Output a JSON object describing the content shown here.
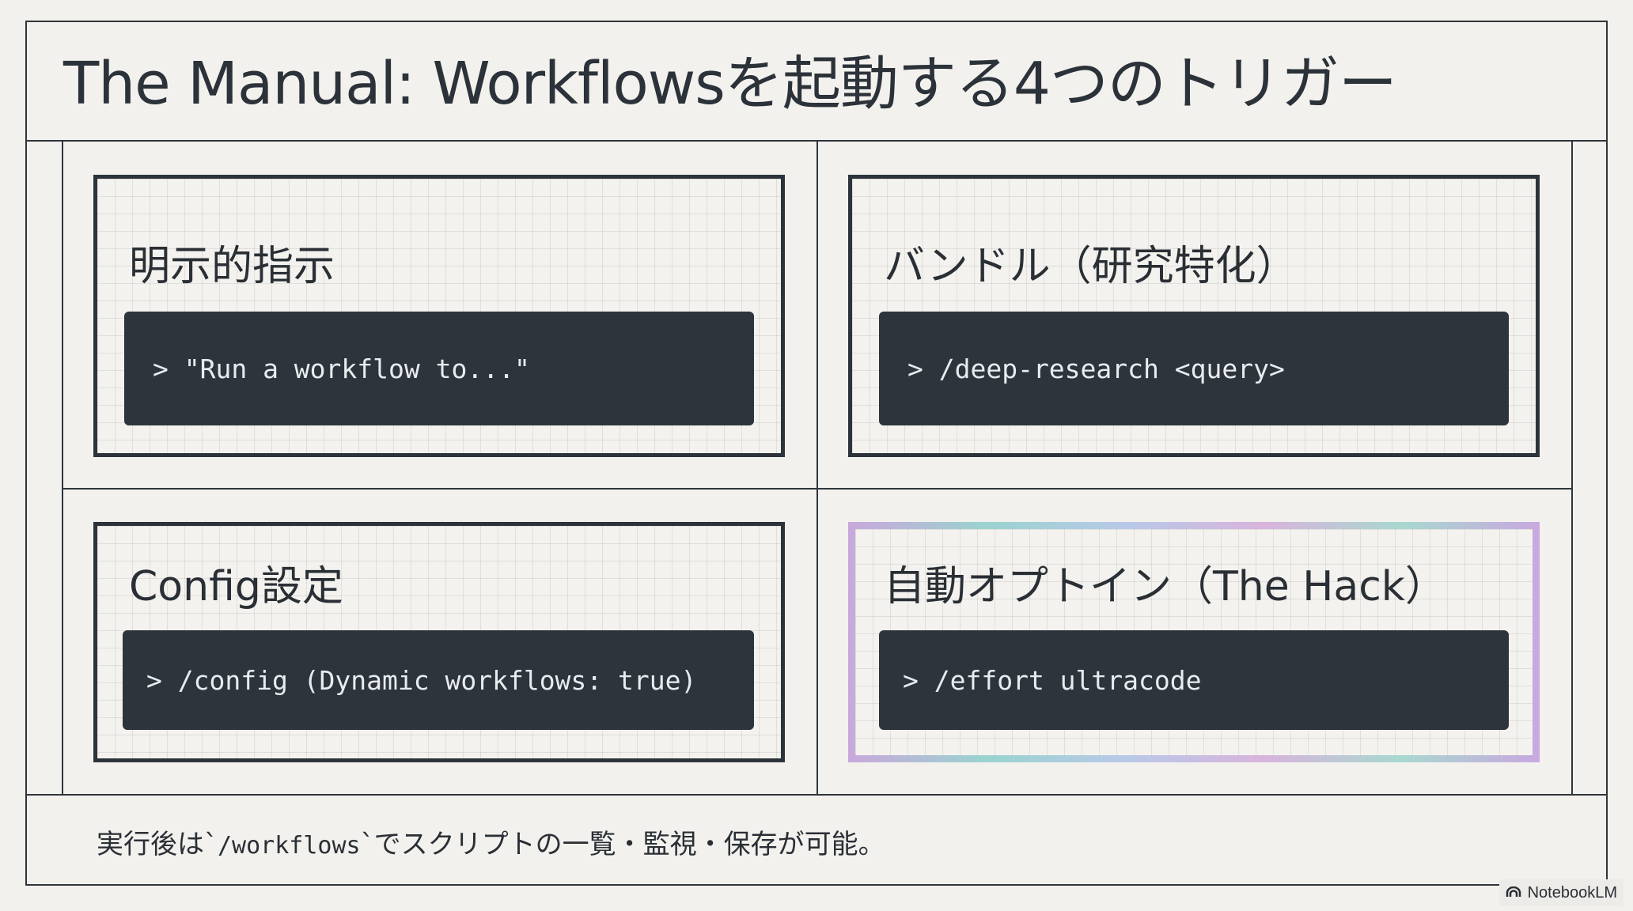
{
  "title": "The Manual: Workflowsを起動する4つのトリガー",
  "cards": [
    {
      "title": "明示的指示",
      "command": "> \"Run a workflow to...\""
    },
    {
      "title": "バンドル（研究特化）",
      "command": "> /deep-research <query>"
    },
    {
      "title": "Config設定",
      "command": "> /config (Dynamic workflows: true)"
    },
    {
      "title": "自動オプトイン（The Hack）",
      "command": "> /effort ultracode"
    }
  ],
  "footer": {
    "prefix": "実行後は`",
    "code": "/workflows",
    "suffix": "`でスクリプトの一覧・監視・保存が可能。"
  },
  "badge": {
    "label": "NotebookLM",
    "icon": "notebooklm-logo-icon"
  },
  "colors": {
    "background": "#f2f1ed",
    "ink": "#2c3239",
    "command_bg": "#2d343c",
    "command_text": "#e9ecef"
  }
}
